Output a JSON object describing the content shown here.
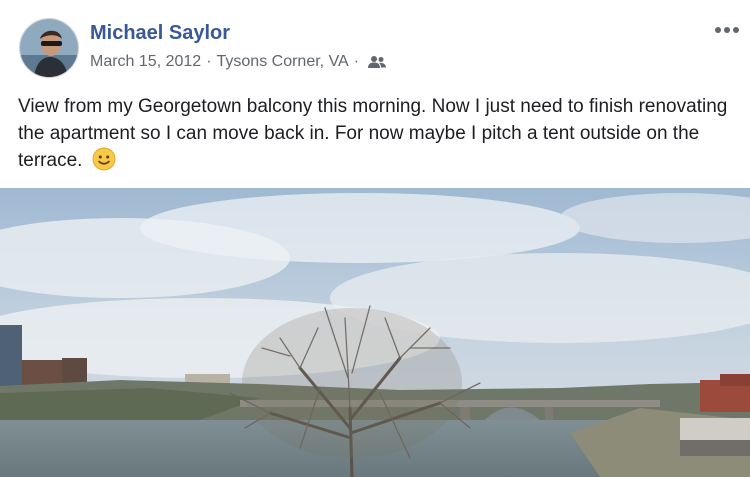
{
  "post": {
    "author": "Michael Saylor",
    "date": "March 15, 2012",
    "location": "Tysons Corner, VA",
    "separator": "·",
    "audience_icon": "friends-icon",
    "more_icon": "more-options-icon",
    "text": "View from my Georgetown balcony this morning. Now I just need to finish renovating the apartment so I can move back in. For now maybe I pitch a tent outside on the terrace.",
    "emoji": "smiling-face-emoji"
  },
  "colors": {
    "author_link": "#385898",
    "meta_text": "#616770",
    "body_text": "#1c1e21"
  }
}
